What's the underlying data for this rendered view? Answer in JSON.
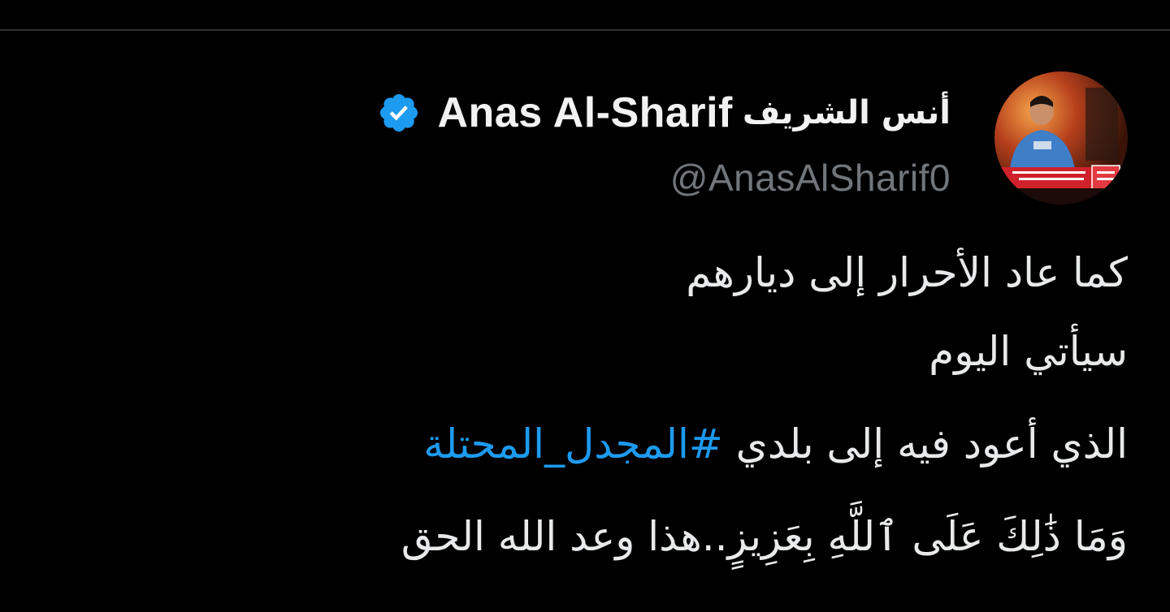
{
  "tweet": {
    "author": {
      "name_arabic": "أنس الشريف",
      "name_latin": "Anas Al-Sharif",
      "handle": "@AnasAlSharif0",
      "verified_icon": "verified-badge-icon",
      "avatar_icon": "profile-photo"
    },
    "lines": [
      "كما عاد الأحرار إلى ديارهم",
      "سيأتي اليوم",
      "الذي أعود فيه إلى بلدي",
      "وَمَا ذَٰلِكَ عَلَى ٱللَّهِ بِعَزِيزٍ..هذا وعد الله الحق"
    ],
    "hashtag": "#المجدل_المحتلة"
  },
  "colors": {
    "background": "#000000",
    "text": "#e7e9ea",
    "handle": "#71767b",
    "hashtag": "#1d9bf0",
    "verified": "#1d9bf0"
  }
}
